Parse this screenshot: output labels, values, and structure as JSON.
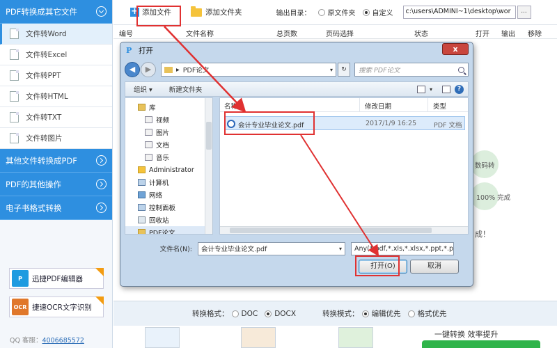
{
  "sidebar": {
    "top_category": "PDF转换成其它文件",
    "items": [
      {
        "label": "文件转Word",
        "active": true
      },
      {
        "label": "文件转Excel",
        "active": false
      },
      {
        "label": "文件转PPT",
        "active": false
      },
      {
        "label": "文件转HTML",
        "active": false
      },
      {
        "label": "文件转TXT",
        "active": false
      },
      {
        "label": "文件转图片",
        "active": false
      }
    ],
    "other_categories": [
      "其他文件转换成PDF",
      "PDF的其他操作",
      "电子书格式转换"
    ],
    "promos": [
      {
        "label": "迅捷PDF编辑器",
        "icon": "pdf-editor-icon",
        "color": "#1e9be0"
      },
      {
        "label": "捷速OCR文字识别",
        "icon": "ocr-icon",
        "color": "#e0772a",
        "logo_text": "OCR"
      }
    ],
    "qq_label": "QQ 客服：",
    "qq_number": "4006685572"
  },
  "toolbar": {
    "add_file": "添加文件",
    "add_folder": "添加文件夹",
    "output_label": "输出目录：",
    "option_original": "原文件夹",
    "option_custom": "自定义",
    "selected_option": "自定义",
    "output_path": "c:\\users\\ADMINI~1\\desktop\\wor",
    "more_button": "..."
  },
  "table_header": [
    "编号",
    "文件名称",
    "总页数",
    "页码选择",
    "状态",
    "打开",
    "输出",
    "移除"
  ],
  "background": {
    "partial_text_1": "数码转",
    "progress_text": "100%  完成",
    "partial_text_2": "成！"
  },
  "bottom_bar": {
    "format_label": "转换格式：",
    "format_options": [
      "DOC",
      "DOCX"
    ],
    "selected_format": "DOCX",
    "mode_label": "转换模式：",
    "mode_options": [
      "编辑优先",
      "格式优先"
    ],
    "selected_mode": "编辑优先",
    "slogan": "一键转换  效率提升"
  },
  "dialog": {
    "title": "打开",
    "title_icon": "P",
    "close_icon": "x",
    "breadcrumb": "PDF论文",
    "search_placeholder": "搜索 PDF论文",
    "organize": "组织 ▾",
    "new_folder": "新建文件夹",
    "nav_items": [
      {
        "label": "库",
        "icon": "library-icon",
        "indent": 0
      },
      {
        "label": "视频",
        "icon": "video-icon",
        "indent": 1
      },
      {
        "label": "图片",
        "icon": "picture-icon",
        "indent": 1
      },
      {
        "label": "文档",
        "icon": "documents-icon",
        "indent": 1
      },
      {
        "label": "音乐",
        "icon": "music-icon",
        "indent": 1
      },
      {
        "label": "Administrator",
        "icon": "user-icon",
        "indent": 0
      },
      {
        "label": "计算机",
        "icon": "computer-icon",
        "indent": 0
      },
      {
        "label": "网络",
        "icon": "network-icon",
        "indent": 0
      },
      {
        "label": "控制面板",
        "icon": "control-panel-icon",
        "indent": 0
      },
      {
        "label": "回收站",
        "icon": "recycle-bin-icon",
        "indent": 0
      },
      {
        "label": "PDF论文",
        "icon": "folder-icon",
        "indent": 0,
        "selected": true
      }
    ],
    "columns": [
      "名称",
      "修改日期",
      "类型"
    ],
    "file": {
      "name": "会计专业毕业论文.pdf",
      "date": "2017/1/9 16:25",
      "type": "PDF 文档"
    },
    "filename_label": "文件名(N):",
    "filename_value": "会计专业毕业论文.pdf",
    "filter": "Any(*.pdf,*.xls,*.xlsx,*.ppt,*.pp",
    "open_button": "打开(O)",
    "cancel_button": "取消"
  },
  "annotation_color": "#e03131"
}
